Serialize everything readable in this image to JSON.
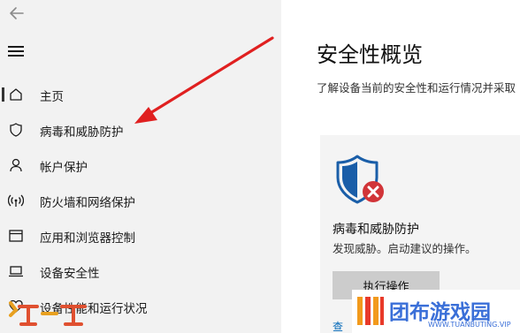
{
  "sidebar": {
    "items": [
      {
        "label": "主页",
        "icon": "home-icon"
      },
      {
        "label": "病毒和威胁防护",
        "icon": "shield-icon"
      },
      {
        "label": "帐户保护",
        "icon": "person-icon"
      },
      {
        "label": "防火墙和网络保护",
        "icon": "wifi-icon"
      },
      {
        "label": "应用和浏览器控制",
        "icon": "browser-window-icon"
      },
      {
        "label": "设备安全性",
        "icon": "laptop-icon"
      },
      {
        "label": "设备性能和运行状况",
        "icon": "heart-icon"
      }
    ],
    "selected_index": 0
  },
  "main": {
    "title": "安全性概览",
    "subtitle": "了解设备当前的安全性和运行情况并采取",
    "card": {
      "title": "病毒和威胁防护",
      "description": "发现威胁。启动建议的操作。",
      "button_label": "执行操作",
      "link_text": "查",
      "status": "error"
    }
  },
  "watermark": {
    "left_text": "玩一玩",
    "right_text": "团布游戏园",
    "right_url": "WWW.TUANBUTING.VIP"
  },
  "colors": {
    "sidebar_bg": "#f2f2f2",
    "shield_blue": "#1a5ea8",
    "error_red": "#d13438",
    "arrow_red": "#e02020",
    "button_gray": "#cccccc"
  }
}
